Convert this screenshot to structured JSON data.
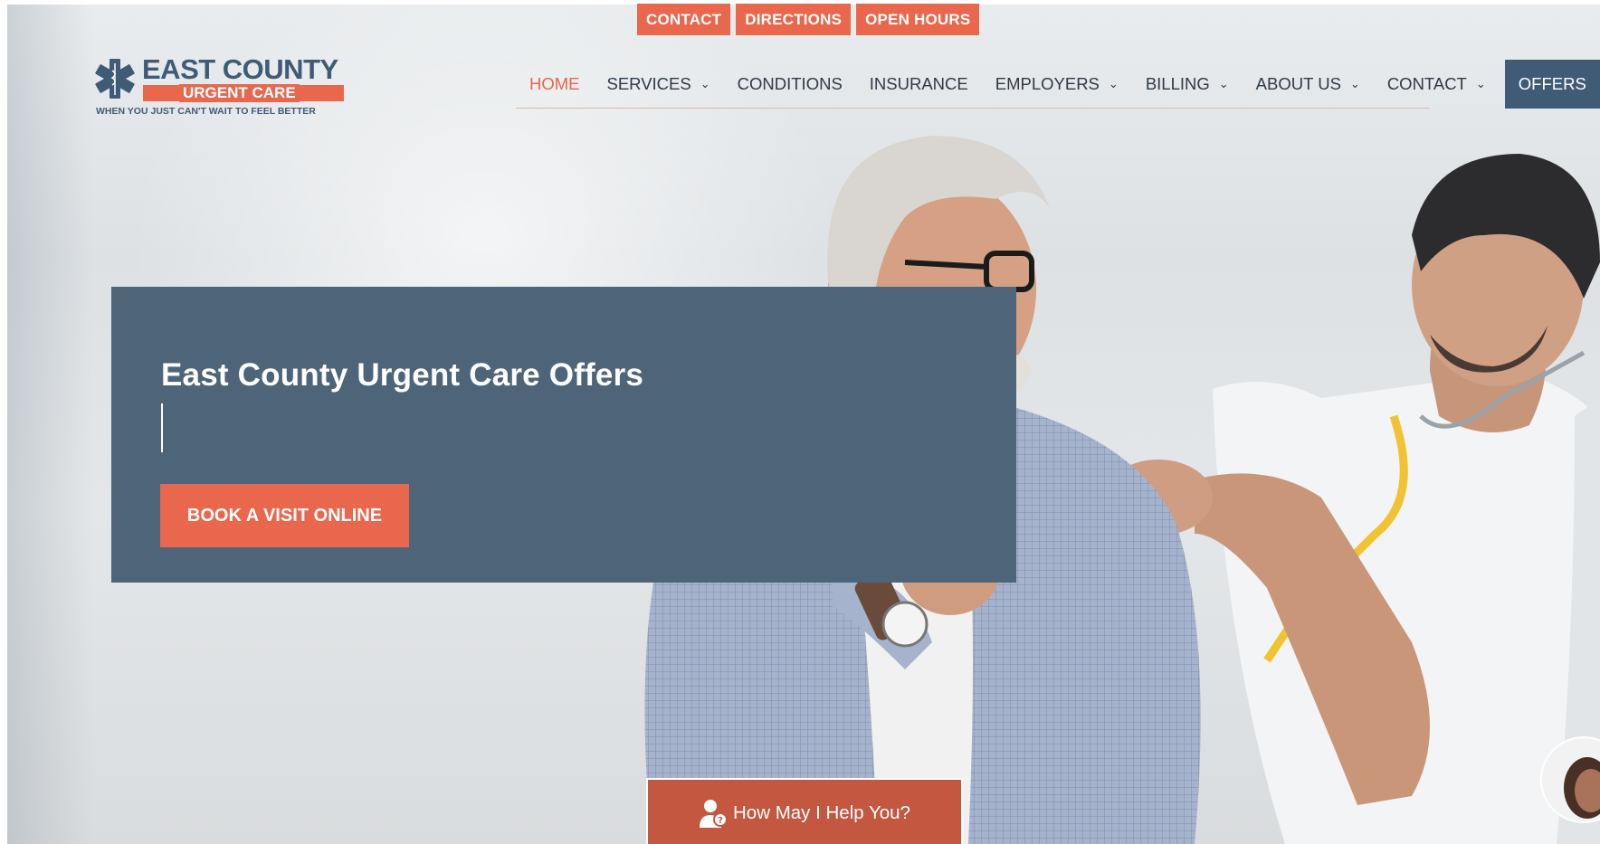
{
  "topbar": {
    "links": [
      "CONTACT",
      "DIRECTIONS",
      "OPEN HOURS"
    ]
  },
  "logo": {
    "line1": "EAST COUNTY",
    "line2": "URGENT CARE",
    "tagline": "WHEN YOU JUST CAN'T WAIT TO FEEL BETTER"
  },
  "nav": {
    "items": [
      {
        "label": "HOME",
        "dropdown": false
      },
      {
        "label": "SERVICES",
        "dropdown": true
      },
      {
        "label": "CONDITIONS",
        "dropdown": false
      },
      {
        "label": "INSURANCE",
        "dropdown": false
      },
      {
        "label": "EMPLOYERS",
        "dropdown": true
      },
      {
        "label": "BILLING",
        "dropdown": true
      },
      {
        "label": "ABOUT US",
        "dropdown": true
      },
      {
        "label": "CONTACT",
        "dropdown": true
      }
    ],
    "offers": "OFFERS"
  },
  "hero": {
    "title": "East County Urgent Care Offers",
    "cta": "BOOK A VISIT ONLINE"
  },
  "help": {
    "label": "How May I Help You?"
  },
  "colors": {
    "accent": "#e8674d",
    "navy": "#3f5b76",
    "banner": "#4e6579"
  },
  "icons": [
    "star-of-life-icon",
    "chevron-down-icon",
    "user-question-icon"
  ]
}
